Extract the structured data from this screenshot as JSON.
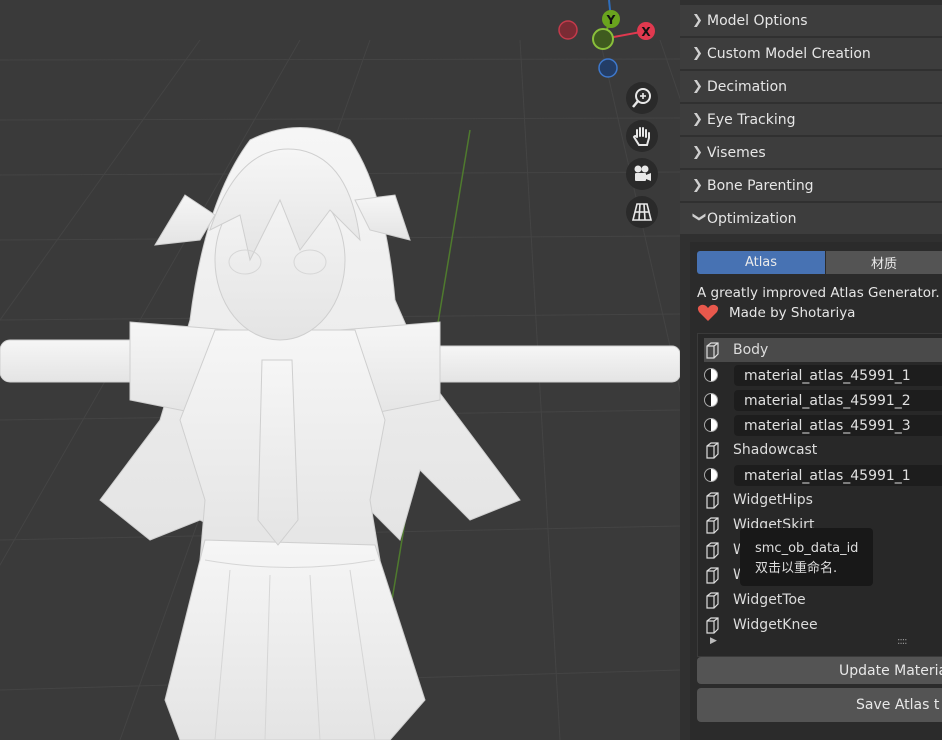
{
  "gizmo": {
    "y_label": "Y",
    "x_label": "X"
  },
  "viewport_tools": [
    {
      "icon": "zoom-icon"
    },
    {
      "icon": "pan-hand-icon"
    },
    {
      "icon": "camera-icon"
    },
    {
      "icon": "perspective-grid-icon"
    }
  ],
  "sections": [
    {
      "label": "Model Options",
      "expanded": false
    },
    {
      "label": "Custom Model Creation",
      "expanded": false
    },
    {
      "label": "Decimation",
      "expanded": false
    },
    {
      "label": "Eye Tracking",
      "expanded": false
    },
    {
      "label": "Visemes",
      "expanded": false
    },
    {
      "label": "Bone Parenting",
      "expanded": false
    },
    {
      "label": "Optimization",
      "expanded": true
    }
  ],
  "optimization": {
    "tabs": [
      {
        "label": "Atlas",
        "active": true
      },
      {
        "label": "材质",
        "active": false
      }
    ],
    "description": "A greatly improved Atlas Generator.",
    "credit": "Made by Shotariya",
    "list": [
      {
        "type": "object",
        "label": "Body",
        "selected": true
      },
      {
        "type": "material",
        "label": "material_atlas_45991_1"
      },
      {
        "type": "material",
        "label": "material_atlas_45991_2"
      },
      {
        "type": "material",
        "label": "material_atlas_45991_3"
      },
      {
        "type": "object",
        "label": "Shadowcast"
      },
      {
        "type": "material",
        "label": "material_atlas_45991_1"
      },
      {
        "type": "object",
        "label": "WidgetHips"
      },
      {
        "type": "object",
        "label": "WidgetSkirt"
      },
      {
        "type": "object",
        "label": "W"
      },
      {
        "type": "object",
        "label": "W"
      },
      {
        "type": "object",
        "label": "WidgetToe"
      },
      {
        "type": "object",
        "label": "WidgetKnee"
      }
    ],
    "list_footer": {
      "expand_glyph": "▶",
      "resize_grip": "::::"
    },
    "tooltip": {
      "line1": "smc_ob_data_id",
      "line2": "双击以重命名."
    },
    "buttons": {
      "update": "Update Materia",
      "save": "Save Atlas t"
    }
  },
  "colors": {
    "accent": "#4772b3",
    "heart": "#e8584c",
    "gizmo_x": "#e0394f",
    "gizmo_y": "#6aa41e",
    "gizmo_z": "#2e6ebc"
  }
}
